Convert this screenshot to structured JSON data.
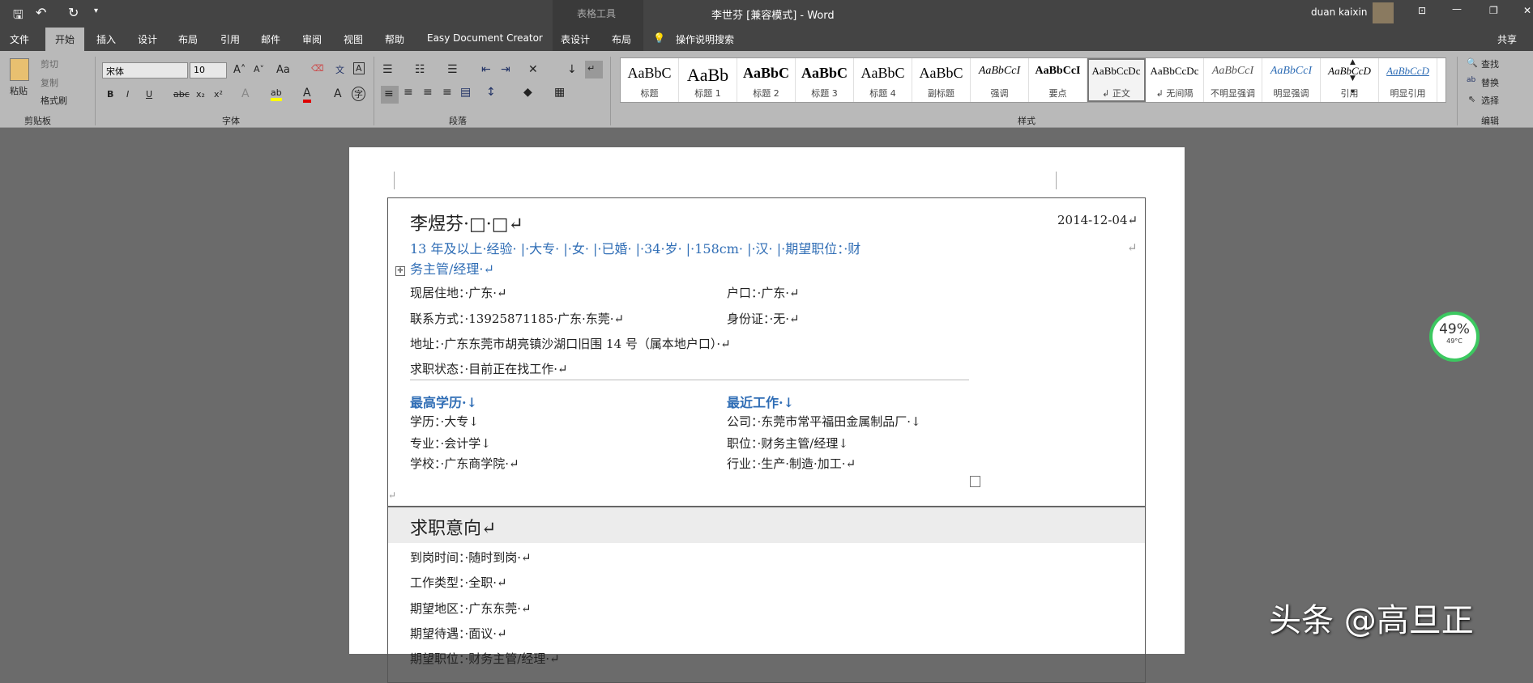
{
  "window": {
    "title": "李世芬 [兼容模式]  -  Word",
    "context_tab": "表格工具",
    "user": "duan kaixin",
    "share": "共享"
  },
  "tabs": [
    "文件",
    "开始",
    "插入",
    "设计",
    "布局",
    "引用",
    "邮件",
    "审阅",
    "视图",
    "帮助",
    "Easy Document Creator",
    "表设计",
    "布局"
  ],
  "search_label": "操作说明搜索",
  "clipboard": {
    "paste": "粘贴",
    "cut": "剪切",
    "copy": "复制",
    "format_painter": "格式刷",
    "group": "剪贴板"
  },
  "font": {
    "name": "宋体",
    "size": "10",
    "group": "字体",
    "bold": "B",
    "italic": "I",
    "underline": "U",
    "strike": "abc",
    "sub": "x₂",
    "sup": "x²",
    "grow": "A˄",
    "shrink": "A˅",
    "case": "Aa",
    "char": "A"
  },
  "paragraph": {
    "group": "段落"
  },
  "styles": {
    "group": "样式",
    "items": [
      {
        "s": "AaBbC",
        "l": "标题"
      },
      {
        "s": "AaBb",
        "l": "标题 1"
      },
      {
        "s": "AaBbC",
        "l": "标题 2"
      },
      {
        "s": "AaBbC",
        "l": "标题 3"
      },
      {
        "s": "AaBbC",
        "l": "标题 4"
      },
      {
        "s": "AaBbC",
        "l": "副标题"
      },
      {
        "s": "AaBbCcI",
        "l": "强调"
      },
      {
        "s": "AaBbCcI",
        "l": "要点"
      },
      {
        "s": "AaBbCcDc",
        "l": "↲ 正文"
      },
      {
        "s": "AaBbCcDc",
        "l": "↲ 无间隔"
      },
      {
        "s": "AaBbCcI",
        "l": "不明显强调"
      },
      {
        "s": "AaBbCcI",
        "l": "明显强调"
      },
      {
        "s": "AaBbCcD",
        "l": "引用"
      },
      {
        "s": "AaBbCcD",
        "l": "明显引用"
      }
    ]
  },
  "editing": {
    "group": "编辑",
    "find": "查找",
    "replace": "替换",
    "select": "选择"
  },
  "doc": {
    "name": "李煜芬·□·□↵",
    "date": "2014-12-04↵",
    "summary1": "13 年及以上·经验· |·大专· |·女· |·已婚· |·34·岁· |·158cm· |·汉· |·期望职位：·财",
    "summary2": "务主管/经理·↵",
    "residence": "现居住地：·广东·↵",
    "hukou": "户口：·广东·↵",
    "contact": "联系方式：·13925871185·广东·东莞·↵",
    "idcard": "身份证：·无·↵",
    "address": "地址：·广东东莞市胡亮镇沙湖口旧围 14 号（属本地户口）·↵",
    "status": "求职状态：·目前正在找工作·↵",
    "edu_heading": "最高学历·↓",
    "work_heading": "最近工作·↓",
    "degree": "学历：·大专↓",
    "major": "专业：·会计学↓",
    "school": "学校：·广东商学院·↵",
    "company": "公司：·东莞市常平福田金属制品厂·↓",
    "position": "职位：·财务主管/经理↓",
    "industry": "行业：·生产·制造·加工·↵",
    "intent_heading": "求职意向↵",
    "arrival": "到岗时间：·随时到岗·↵",
    "type": "工作类型：·全职·↵",
    "region": "期望地区：·广东东莞·↵",
    "salary": "期望待遇：·面议·↵",
    "job": "期望职位：·财务主管/经理·↵"
  },
  "widget": {
    "percent": "49%",
    "temp": "49°C"
  },
  "watermark": "头条 @高旦正"
}
